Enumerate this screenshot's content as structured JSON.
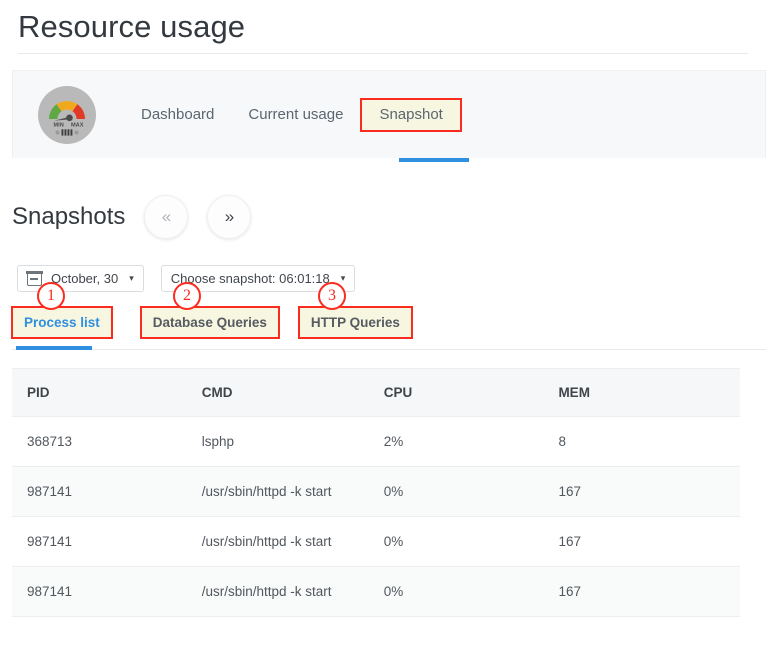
{
  "page": {
    "title": "Resource usage"
  },
  "header": {
    "gauge_icon": "gauge-icon",
    "gauge_min_label": "MIN",
    "gauge_max_label": "MAX",
    "tabs": [
      {
        "label": "Dashboard",
        "active": false,
        "annotated": false
      },
      {
        "label": "Current usage",
        "active": false,
        "annotated": false
      },
      {
        "label": "Snapshot",
        "active": true,
        "annotated": true
      }
    ]
  },
  "snapshots": {
    "heading": "Snapshots",
    "prev_label": "«",
    "next_label": "»",
    "date_select": {
      "icon": "calendar-icon",
      "value": "October, 30",
      "caret": "▾"
    },
    "snapshot_select": {
      "value": "Choose snapshot: 06:01:18",
      "caret": "▾"
    }
  },
  "subtabs": [
    {
      "label": "Process list",
      "active": true,
      "badge": "1"
    },
    {
      "label": "Database Queries",
      "active": false,
      "badge": "2"
    },
    {
      "label": "HTTP Queries",
      "active": false,
      "badge": "3"
    }
  ],
  "table": {
    "columns": [
      "PID",
      "CMD",
      "CPU",
      "MEM"
    ],
    "rows": [
      [
        "368713",
        "lsphp",
        "2%",
        "8"
      ],
      [
        "987141",
        "/usr/sbin/httpd -k start",
        "0%",
        "167"
      ],
      [
        "987141",
        "/usr/sbin/httpd -k start",
        "0%",
        "167"
      ],
      [
        "987141",
        "/usr/sbin/httpd -k start",
        "0%",
        "167"
      ]
    ]
  },
  "colors": {
    "accent_blue": "#2f8fe0",
    "annotation_red": "#fc2b20",
    "annotation_fill": "#f7f6e0",
    "card_bg": "#f6f8f9"
  }
}
